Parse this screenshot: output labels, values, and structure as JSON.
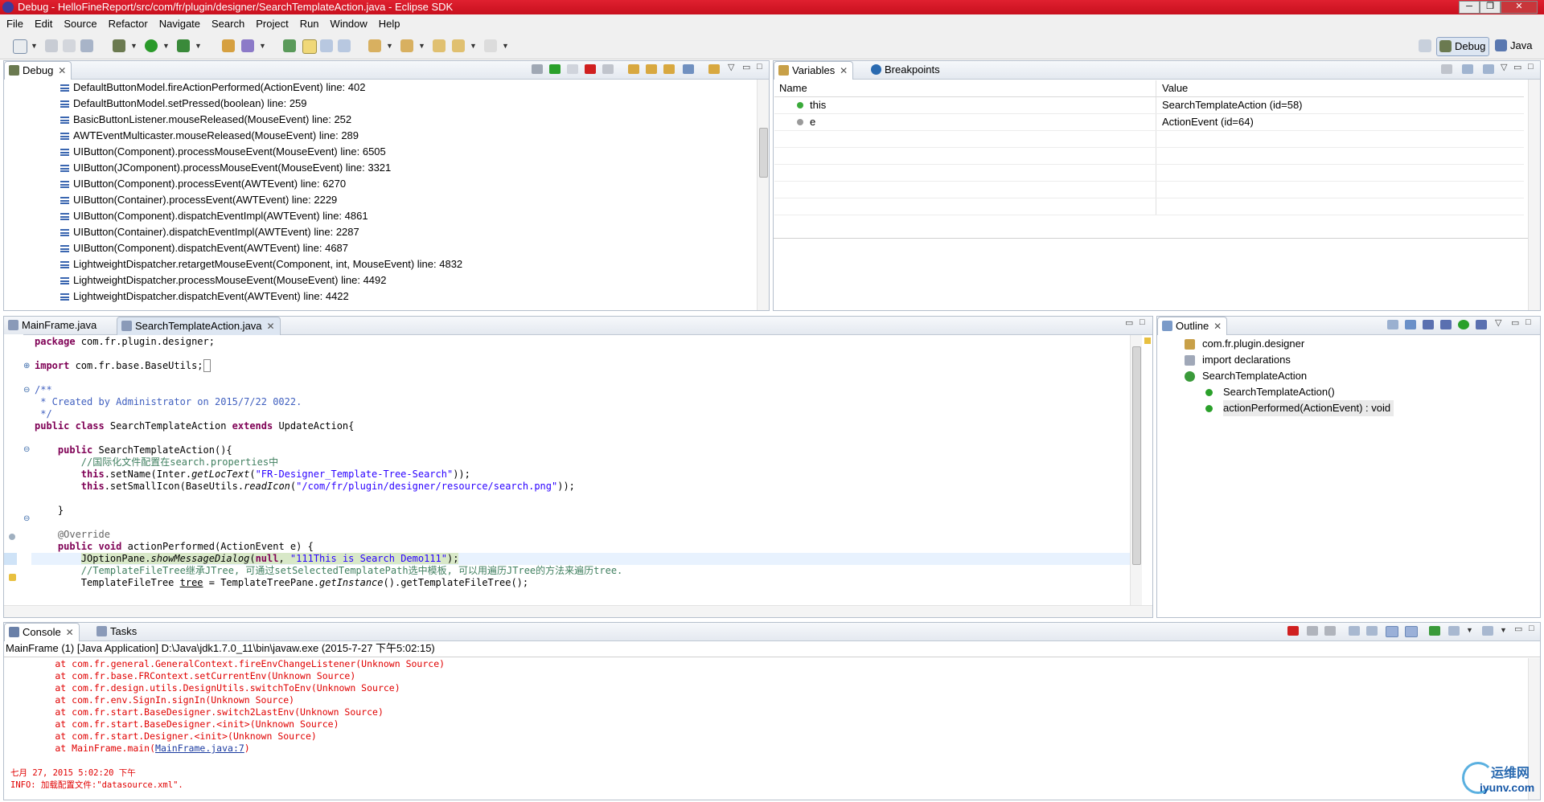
{
  "window": {
    "title": "Debug - HelloFineReport/src/com/fr/plugin/designer/SearchTemplateAction.java - Eclipse SDK",
    "min": "─",
    "restore": "❐",
    "close": "✕"
  },
  "menu": [
    "File",
    "Edit",
    "Source",
    "Refactor",
    "Navigate",
    "Search",
    "Project",
    "Run",
    "Window",
    "Help"
  ],
  "perspectives": {
    "debug": "Debug",
    "java": "Java"
  },
  "debug_view": {
    "tab": "Debug",
    "frames": [
      "DefaultButtonModel.fireActionPerformed(ActionEvent) line: 402",
      "DefaultButtonModel.setPressed(boolean) line: 259",
      "BasicButtonListener.mouseReleased(MouseEvent) line: 252",
      "AWTEventMulticaster.mouseReleased(MouseEvent) line: 289",
      "UIButton(Component).processMouseEvent(MouseEvent) line: 6505",
      "UIButton(JComponent).processMouseEvent(MouseEvent) line: 3321",
      "UIButton(Component).processEvent(AWTEvent) line: 6270",
      "UIButton(Container).processEvent(AWTEvent) line: 2229",
      "UIButton(Component).dispatchEventImpl(AWTEvent) line: 4861",
      "UIButton(Container).dispatchEventImpl(AWTEvent) line: 2287",
      "UIButton(Component).dispatchEvent(AWTEvent) line: 4687",
      "LightweightDispatcher.retargetMouseEvent(Component, int, MouseEvent) line: 4832",
      "LightweightDispatcher.processMouseEvent(MouseEvent) line: 4492",
      "LightweightDispatcher.dispatchEvent(AWTEvent) line: 4422"
    ]
  },
  "variables_view": {
    "tabs": [
      "Variables",
      "Breakpoints"
    ],
    "columns": [
      "Name",
      "Value"
    ],
    "rows": [
      {
        "name": "this",
        "value": "SearchTemplateAction  (id=58)"
      },
      {
        "name": "e",
        "value": "ActionEvent  (id=64)"
      }
    ]
  },
  "editor": {
    "tabs": [
      "MainFrame.java",
      "SearchTemplateAction.java"
    ]
  },
  "outline_view": {
    "tab": "Outline",
    "items": [
      "com.fr.plugin.designer",
      "import declarations",
      "SearchTemplateAction",
      "SearchTemplateAction()",
      "actionPerformed(ActionEvent) : void"
    ]
  },
  "console_view": {
    "tabs": [
      "Console",
      "Tasks"
    ],
    "process": "MainFrame (1) [Java Application] D:\\Java\\jdk1.7.0_11\\bin\\javaw.exe (2015-7-27 下午5:02:15)",
    "trace": [
      "        at com.fr.general.GeneralContext.fireEnvChangeListener(Unknown Source)",
      "        at com.fr.base.FRContext.setCurrentEnv(Unknown Source)",
      "        at com.fr.design.utils.DesignUtils.switchToEnv(Unknown Source)",
      "        at com.fr.env.SignIn.signIn(Unknown Source)",
      "        at com.fr.start.BaseDesigner.switch2LastEnv(Unknown Source)",
      "        at com.fr.start.BaseDesigner.<init>(Unknown Source)",
      "        at com.fr.start.Designer.<init>(Unknown Source)"
    ],
    "last_prefix": "        at MainFrame.main(",
    "last_link": "MainFrame.java:7",
    "last_suffix": ")",
    "date_line": "七月 27, 2015 5:02:20 下午",
    "info_line": "INFO: 加载配置文件:\"datasource.xml\"."
  },
  "watermark": {
    "cn": "运维网",
    "domain": "iyunv.com"
  }
}
